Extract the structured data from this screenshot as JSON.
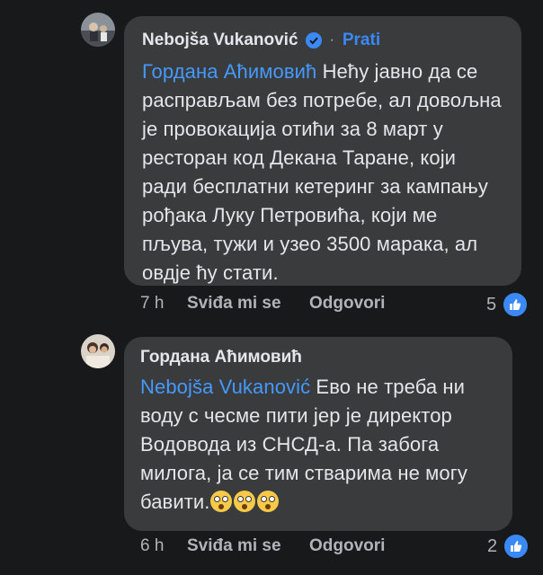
{
  "comments": [
    {
      "author": "Nebojša Vukanović",
      "follow": "Prati",
      "dot": "·",
      "mention": "Гордана Аћимовић",
      "text": " Нећу јавно да се расправљам без потребе, ал довољна је провокација отићи за 8 март у ресторан код Декана Таране, који ради бесплатни кетеринг за кампању рођака Луку Петровића, који ме пљува, тужи и узео 3500 марака, ал овдје ћу стати.",
      "time": "7 h",
      "like_label": "Sviđa mi se",
      "reply_label": "Odgovori",
      "reactions": "5"
    },
    {
      "author": "Гордана Аћимовић",
      "mention": "Nebojša Vukanović",
      "text": " Ево не треба ни воду с чесме пити јер је директор Водовода из СНСД-а. Па забога милога, ја се тим стварима не могу бавити.",
      "time": "6 h",
      "like_label": "Sviđa mi se",
      "reply_label": "Odgovori",
      "reactions": "2"
    }
  ],
  "icons": {
    "verified": "verified-badge-icon",
    "like": "thumbs-up-icon",
    "emoji": "flushed-face-emoji"
  },
  "colors": {
    "background": "#18191a",
    "bubble": "#3a3b3c",
    "accent": "#3a89f7"
  }
}
